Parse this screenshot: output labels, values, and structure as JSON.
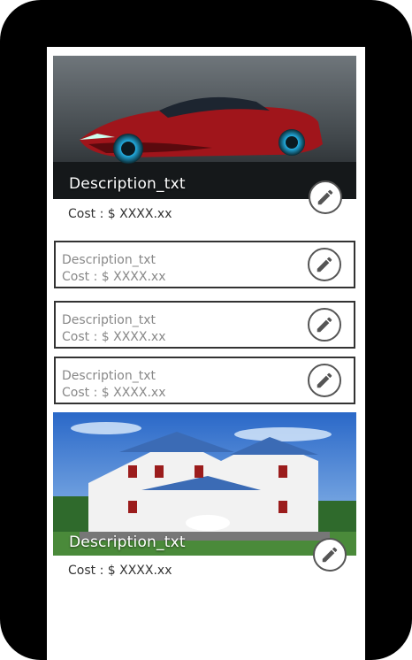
{
  "cards": [
    {
      "description": "Description_txt",
      "cost": "Cost : $ XXXX.xx",
      "image": "sports-car-photo",
      "edit_icon": "pencil-icon"
    },
    {
      "description": "Description_txt",
      "cost": "Cost : $ XXXX.xx",
      "edit_icon": "pencil-icon"
    },
    {
      "description": "Description_txt",
      "cost": "Cost : $ XXXX.xx",
      "edit_icon": "pencil-icon"
    },
    {
      "description": "Description_txt",
      "cost": "Cost : $ XXXX.xx",
      "edit_icon": "pencil-icon"
    },
    {
      "description": "Description_txt",
      "cost": "Cost : $ XXXX.xx",
      "image": "house-photo",
      "edit_icon": "pencil-icon"
    }
  ],
  "colors": {
    "frame": "#000000",
    "screen": "#ffffff",
    "edit_border": "#555555"
  }
}
